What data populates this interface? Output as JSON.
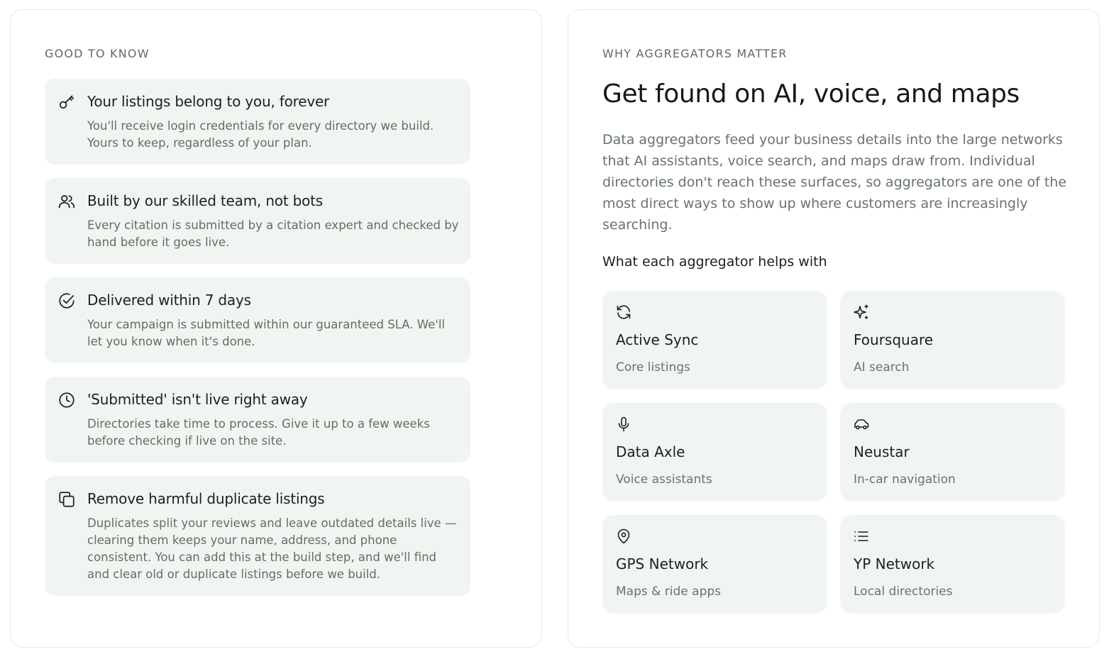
{
  "good_to_know": {
    "heading": "GOOD TO KNOW",
    "items": [
      {
        "icon": "key-icon",
        "title": "Your listings belong to you, forever",
        "body": "You'll receive login credentials for every directory we build. Yours to keep, regardless of your plan."
      },
      {
        "icon": "users-icon",
        "title": "Built by our skilled team, not bots",
        "body": "Every citation is submitted by a citation expert and checked by hand before it goes live."
      },
      {
        "icon": "check-circle-icon",
        "title": "Delivered within 7 days",
        "body": "Your campaign is submitted within our guaranteed SLA. We'll let you know when it's done."
      },
      {
        "icon": "clock-icon",
        "title": "'Submitted' isn't live right away",
        "body": "Directories take time to process. Give it up to a few weeks before checking if live on the site."
      },
      {
        "icon": "copy-icon",
        "title": "Remove harmful duplicate listings",
        "body": "Duplicates split your reviews and leave outdated details live — clearing them keeps your name, address, and phone consistent. You can add this at the build step, and we'll find and clear old or duplicate listings before we build."
      }
    ]
  },
  "aggregators": {
    "heading": "WHY AGGREGATORS MATTER",
    "title": "Get found on AI, voice, and maps",
    "lede": "Data aggregators feed your business details into the large networks that AI assistants, voice search, and maps draw from. Individual directories don't reach these surfaces, so aggregators are one of the most direct ways to show up where customers are increasingly searching.",
    "subheading": "What each aggregator helps with",
    "cards": [
      {
        "icon": "refresh-icon",
        "name": "Active Sync",
        "desc": "Core listings"
      },
      {
        "icon": "sparkles-icon",
        "name": "Foursquare",
        "desc": "AI search"
      },
      {
        "icon": "microphone-icon",
        "name": "Data Axle",
        "desc": "Voice assistants"
      },
      {
        "icon": "car-icon",
        "name": "Neustar",
        "desc": "In-car navigation"
      },
      {
        "icon": "map-pin-icon",
        "name": "GPS Network",
        "desc": "Maps & ride apps"
      },
      {
        "icon": "list-icon",
        "name": "YP Network",
        "desc": "Local directories"
      }
    ]
  }
}
